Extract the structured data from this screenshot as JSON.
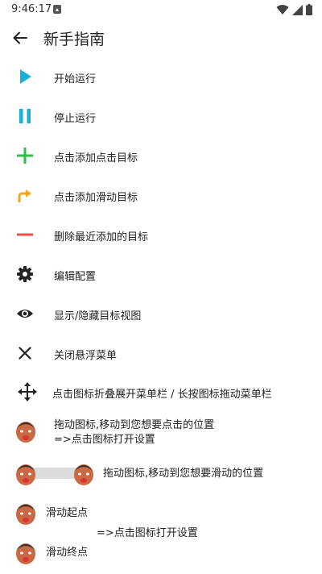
{
  "status_bar": {
    "time": "9:46:17"
  },
  "app_bar": {
    "title": "新手指南",
    "back_icon": "arrow-left-icon"
  },
  "colors": {
    "play": "#1AAFD6",
    "pause": "#1AAFD6",
    "add_click": "#2DBE4C",
    "add_swipe": "#F5A623",
    "remove": "#EB4D4D",
    "dark_icon": "#222222"
  },
  "guide_items": [
    {
      "icon": "play-icon",
      "label": "开始运行"
    },
    {
      "icon": "pause-icon",
      "label": "停止运行"
    },
    {
      "icon": "plus-icon",
      "label": "点击添加点击目标"
    },
    {
      "icon": "curved-arrow-icon",
      "label": "点击添加滑动目标"
    },
    {
      "icon": "minus-icon",
      "label": "删除最近添加的目标"
    },
    {
      "icon": "gear-icon",
      "label": "编辑配置"
    },
    {
      "icon": "eye-icon",
      "label": "显示/隐藏目标视图"
    },
    {
      "icon": "close-icon",
      "label": "关闭悬浮菜单"
    },
    {
      "icon": "move-icon",
      "label": "点击图标折叠展开菜单栏 / 长按图标拖动菜单栏"
    }
  ],
  "click_target_hint": {
    "line1": "拖动图标,移动到您想要点击的位置",
    "line2": "=>点击图标打开设置"
  },
  "swipe_target_hint": {
    "text": "拖动图标,移动到您想要滑动的位置"
  },
  "swipe_points": {
    "start_label": "滑动起点",
    "open_settings": "=>点击图标打开设置",
    "end_label": "滑动终点"
  }
}
